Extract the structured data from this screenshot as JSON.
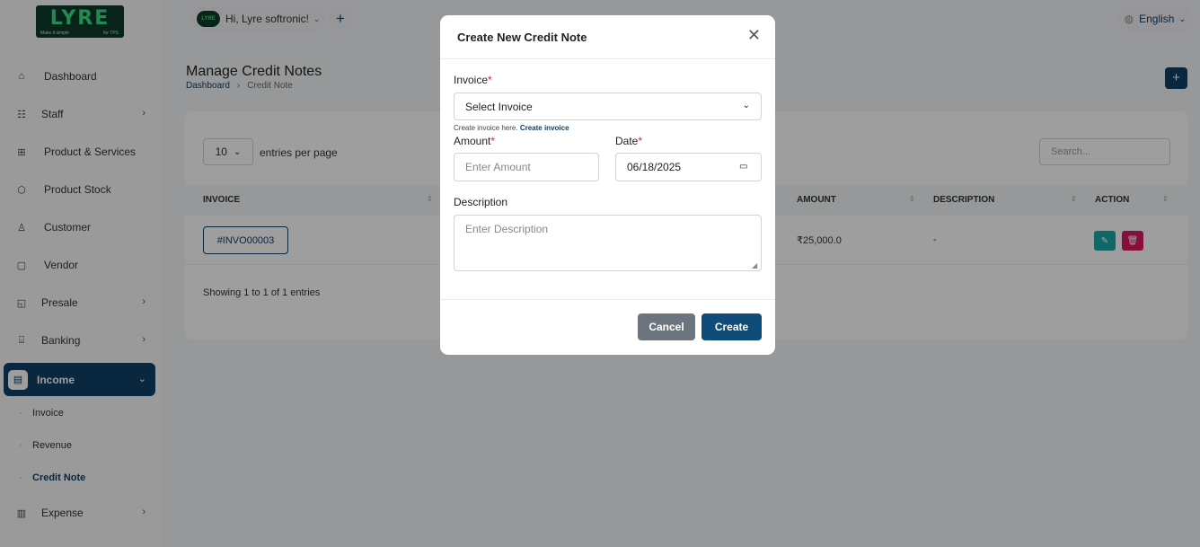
{
  "logo": {
    "text": "LYRE",
    "tagline_left": "Make it simple",
    "tagline_right": "for TPS"
  },
  "topbar": {
    "user_avatar_text": "LYRE",
    "user_greeting": "Hi, Lyre softronic!",
    "language": "English"
  },
  "sidebar": {
    "items": [
      {
        "label": "Dashboard",
        "icon": "home-icon",
        "chevron": ""
      },
      {
        "label": "Staff",
        "icon": "users-icon",
        "chevron": "›"
      },
      {
        "label": "Product & Services",
        "icon": "cart-icon",
        "chevron": ""
      },
      {
        "label": "Product Stock",
        "icon": "box-icon",
        "chevron": ""
      },
      {
        "label": "Customer",
        "icon": "user-plus-icon",
        "chevron": ""
      },
      {
        "label": "Vendor",
        "icon": "note-icon",
        "chevron": ""
      },
      {
        "label": "Presale",
        "icon": "presale-icon",
        "chevron": "›"
      },
      {
        "label": "Banking",
        "icon": "bank-icon",
        "chevron": "›"
      },
      {
        "label": "Income",
        "icon": "file-icon",
        "chevron": "⌄"
      },
      {
        "label": "Expense",
        "icon": "clipboard-icon",
        "chevron": "›"
      }
    ],
    "income_sub": [
      {
        "label": "Invoice"
      },
      {
        "label": "Revenue"
      },
      {
        "label": "Credit Note"
      }
    ]
  },
  "page": {
    "title": "Manage Credit Notes",
    "breadcrumb_home": "Dashboard",
    "breadcrumb_sep": "›",
    "breadcrumb_current": "Credit Note"
  },
  "table": {
    "entries_value": "10",
    "entries_label": "entries per page",
    "search_placeholder": "Search...",
    "headers": [
      "INVOICE",
      "AMOUNT",
      "DESCRIPTION",
      "ACTION"
    ],
    "rows": [
      {
        "invoice": "#INVO00003",
        "amount": "₹25,000.0",
        "description": "-"
      }
    ],
    "showing": "Showing 1 to 1 of 1 entries"
  },
  "modal": {
    "title": "Create New Credit Note",
    "invoice_label": "Invoice",
    "invoice_select": "Select Invoice",
    "help_text": "Create invoice here.",
    "help_link": "Create invoice",
    "amount_label": "Amount",
    "amount_placeholder": "Enter Amount",
    "date_label": "Date",
    "date_value": "06/18/2025",
    "description_label": "Description",
    "description_placeholder": "Enter Description",
    "required_mark": "*",
    "cancel_label": "Cancel",
    "create_label": "Create"
  }
}
